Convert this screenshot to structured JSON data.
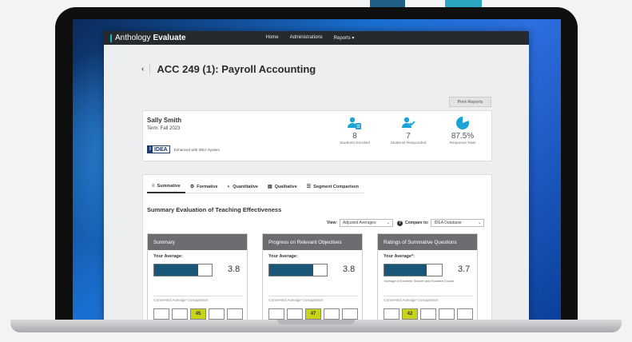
{
  "app": {
    "brand_prefix": "Anthology",
    "brand_name": "Evaluate",
    "nav": [
      "Home",
      "Administrations",
      "Reports ▾"
    ]
  },
  "page": {
    "back_glyph": "‹",
    "title": "ACC 249 (1): Payroll Accounting",
    "print_label": "Print Reports"
  },
  "student_card": {
    "name": "Sally Smith",
    "term": "Term: Fall 2023",
    "idea_logo_i": "I",
    "idea_logo_text": "IDEA",
    "idea_caption": "Enhanced with IDEA System",
    "stats": [
      {
        "icon": "students-enrolled-icon",
        "value": "8",
        "label": "Students Enrolled"
      },
      {
        "icon": "students-responded-icon",
        "value": "7",
        "label": "Students Responded"
      },
      {
        "icon": "response-rate-pie-icon",
        "value": "87.5%",
        "label": "Response Rate"
      }
    ],
    "accent_color": "#1aa3d6"
  },
  "tabs": [
    {
      "icon": "≡",
      "label": "Summative",
      "active": true
    },
    {
      "icon": "⚙",
      "label": "Formative",
      "active": false
    },
    {
      "icon": "◐",
      "label": "Quantitative",
      "active": false
    },
    {
      "icon": "▤",
      "label": "Qualitative",
      "active": false
    },
    {
      "icon": "☰",
      "label": "Segment Comparison",
      "active": false
    }
  ],
  "summary": {
    "title": "Summary Evaluation of Teaching Effectiveness",
    "view_label": "View:",
    "view_value": "Adjusted Averages",
    "compare_label": "Compare to:",
    "compare_value": "IDEA Database"
  },
  "boxes": [
    {
      "title": "Summary",
      "avg_label": "Your Average:",
      "value": "3.8",
      "fill": 0.76,
      "footnote": "",
      "conv_label": "Converted Average Comparison:",
      "squares": [
        "",
        "",
        "45",
        "",
        ""
      ],
      "highlight_index": 2
    },
    {
      "title": "Progress on Relevant Objectives",
      "avg_label": "Your Average:",
      "value": "3.8",
      "fill": 0.76,
      "footnote": "",
      "conv_label": "Converted Average Comparison:",
      "squares": [
        "",
        "",
        "47",
        "",
        ""
      ],
      "highlight_index": 2
    },
    {
      "title": "Ratings of Summative Questions",
      "avg_label": "Your Average*:",
      "value": "3.7",
      "fill": 0.74,
      "footnote": "*Average of Excellent Teacher and Excellent Course",
      "conv_label": "Converted Average Comparison:",
      "squares": [
        "",
        "42",
        "",
        "",
        ""
      ],
      "highlight_index": 1
    }
  ],
  "colors": {
    "bar_fill": "#1a5678",
    "highlight": "#c8d418",
    "box_header": "#6b6d70",
    "topbar": "#262a2e"
  }
}
